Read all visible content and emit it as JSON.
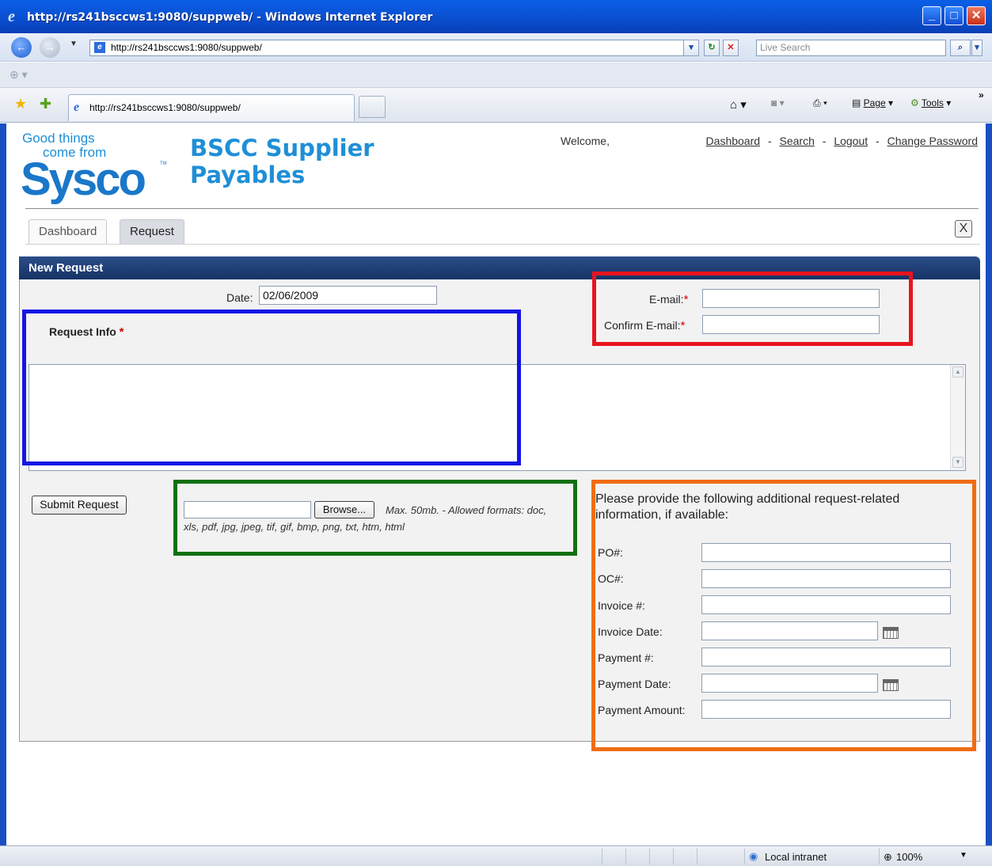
{
  "window": {
    "title": "http://rs241bsccws1:9080/suppweb/ - Windows Internet Explorer",
    "address": "http://rs241bsccws1:9080/suppweb/",
    "search_placeholder": "Live Search",
    "tab_title": "http://rs241bsccws1:9080/suppweb/",
    "tools": {
      "page_label": "Page",
      "tools_label": "Tools"
    }
  },
  "header": {
    "logo": {
      "tagline_1": "Good things",
      "tagline_2": "come from",
      "brand": "Sysco",
      "tm": "TM"
    },
    "app_title_line1": "BSCC Supplier",
    "app_title_line2": "Payables",
    "welcome": "Welcome,",
    "links": {
      "dashboard": "Dashboard",
      "search": "Search",
      "logout": "Logout",
      "change_password": "Change Password",
      "separator": "-"
    }
  },
  "tabs": [
    {
      "label": "Dashboard",
      "active": false
    },
    {
      "label": "Request",
      "active": true
    }
  ],
  "close_label": "X",
  "form": {
    "heading": "New Request",
    "date_label": "Date:",
    "date_value": "02/06/2009",
    "email_label": "E-mail:",
    "confirm_email_label": "Confirm E-mail:",
    "required_mark": "*",
    "request_info_label": "Request Info",
    "submit_label": "Submit Request",
    "browse_label": "Browse...",
    "upload_hint_1": "Max. 50mb. - Allowed formats: doc,",
    "upload_hint_2": "xls, pdf, jpg, jpeg, tif, gif, bmp, png, txt, htm, html",
    "additional_info": "Please provide the following additional request-related information, if available:",
    "fields": {
      "po": "PO#:",
      "oc": "OC#:",
      "invoice_no": "Invoice #:",
      "invoice_date": "Invoice Date:",
      "payment_no": "Payment #:",
      "payment_date": "Payment Date:",
      "payment_amount": "Payment Amount:"
    }
  },
  "annotation_colors": {
    "email_box": "#e8141e",
    "request_info_box": "#1414e6",
    "upload_box": "#127012",
    "additional_box": "#f06c12"
  },
  "status": {
    "zone": "Local intranet",
    "zoom": "100%"
  }
}
